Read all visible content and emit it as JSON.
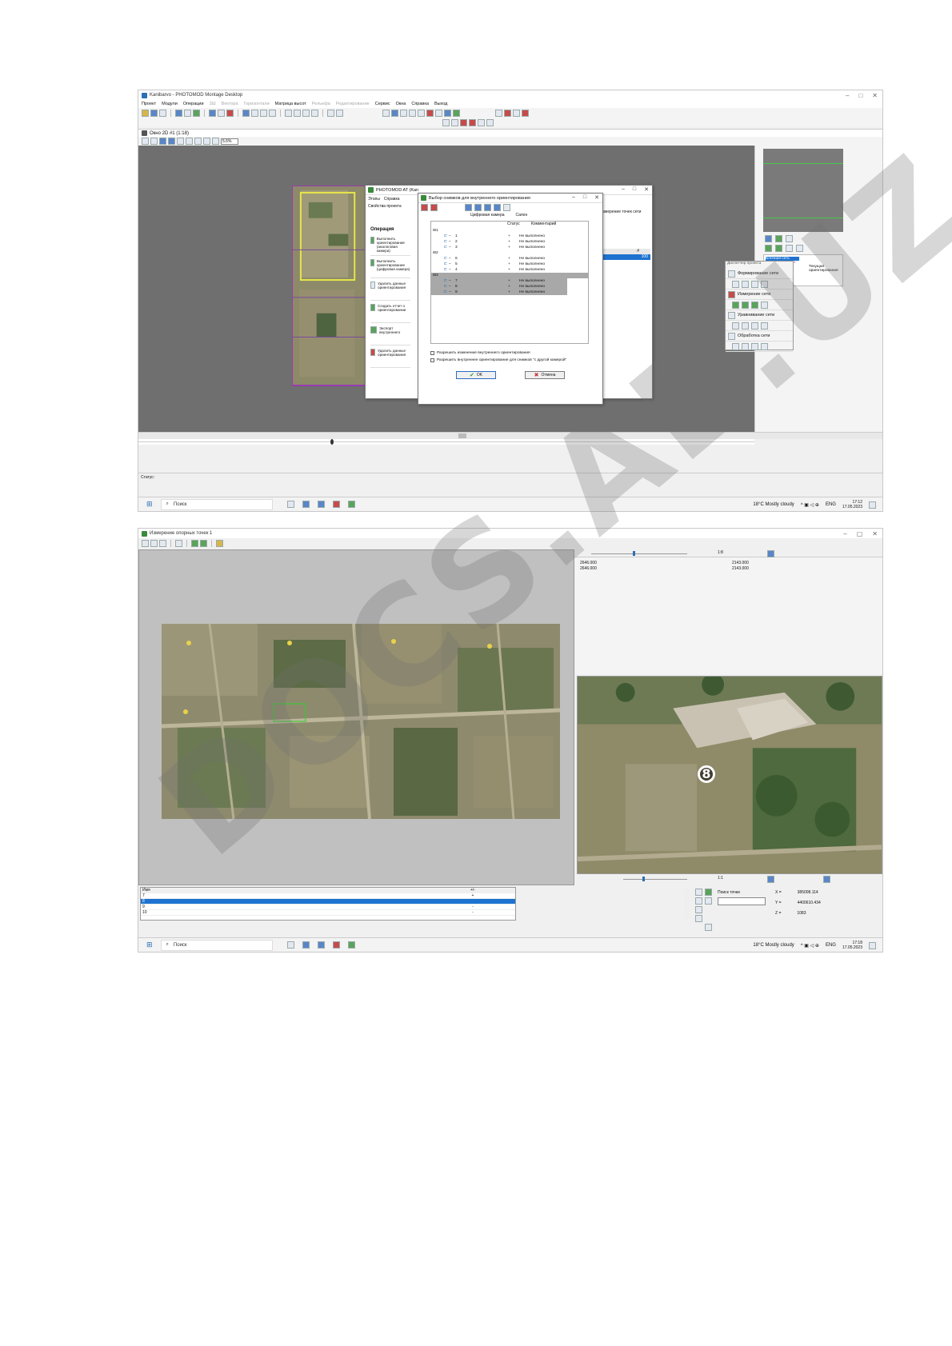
{
  "screenshot1": {
    "window_title": "Kanibarvo - PHOTOMOD Montage Desktop",
    "menu": [
      "Проект",
      "Модули",
      "Операции",
      "3Ш",
      "Вектора",
      "Горизонтали",
      "Матрица высот",
      "Рельефа",
      "Редактирование",
      "Сервис",
      "Окна",
      "Справка",
      "Выход"
    ],
    "menu_disabled": [
      false,
      false,
      false,
      true,
      true,
      true,
      false,
      true,
      true,
      false,
      false,
      false,
      false
    ],
    "doc_window_title": "Окно 2D #1 (1:18)",
    "zoom_value": "5.6%",
    "status_label": "Статус:",
    "at_window": {
      "title": "PHOTOMOD AT (Kan",
      "menu": [
        "Этапы",
        "Справка"
      ],
      "subtab": "Свойства проекта",
      "section_label": "Операция",
      "operations": [
        "Выполнить ориентирование (аналоговая камера)",
        "Выполнить ориентирование (цифровая камера)",
        "Удалить данные ориентирования",
        "Создать отчет о ориентировании",
        "Экспорт внутреннего",
        "Удалить данные ориентирования"
      ],
      "right_tab": "Измерение точек сети",
      "right_col_header": "#",
      "right_value": "100"
    },
    "dialog": {
      "title": "Выбор снимков для внутреннего ориентирования",
      "col_camera": "Цифровая камера",
      "col_sensor": "Сапон",
      "col_status": "Статус",
      "col_comment": "Комментарий",
      "groups": [
        {
          "name": "1",
          "items": [
            {
              "label": "1",
              "status": "+",
              "comment": "Не выполнено"
            },
            {
              "label": "2",
              "status": "+",
              "comment": "Не выполнено"
            },
            {
              "label": "3",
              "status": "+",
              "comment": "Не выполнено"
            }
          ]
        },
        {
          "name": "2",
          "items": [
            {
              "label": "6",
              "status": "+",
              "comment": "Не выполнено"
            },
            {
              "label": "5",
              "status": "+",
              "comment": "Не выполнено"
            },
            {
              "label": "4",
              "status": "+",
              "comment": "Не выполнено"
            }
          ]
        },
        {
          "name": "3",
          "items": [
            {
              "label": "7",
              "status": "+",
              "comment": "Не выполнено"
            },
            {
              "label": "8",
              "status": "+",
              "comment": "Не выполнено"
            },
            {
              "label": "9",
              "status": "+",
              "comment": "Не выполнено"
            }
          ]
        }
      ],
      "option1": "Разрешить изменение внутреннего ориентирования",
      "option2": "Разрешить внутреннее ориентирование для снимков \"с другой камерой\"",
      "ok": "OK",
      "cancel": "Отмена"
    },
    "manager": {
      "title": "Диспетчер проекта",
      "tree_root": "Блочная сеть",
      "tree_item1": "Маркер",
      "tree_item2": "Текущая",
      "tree_item3": "ориентирования",
      "items": [
        "Формирование сети",
        "Измерение сети",
        "Уравнивание сети",
        "Обработка сети"
      ]
    },
    "taskbar": {
      "search": "Поиск",
      "weather": "18°C  Mostly cloudy",
      "lang": "ENG",
      "time": "17:12",
      "date": "17.05.2023"
    }
  },
  "screenshot2": {
    "window_title": "Измерение опорных точек 1",
    "scale_top": "1:8",
    "scale_bottom": "1:1",
    "coords_top": [
      [
        "2646.000",
        "2143.000"
      ],
      [
        "2646.000",
        "2143.000"
      ]
    ],
    "point_label": "8",
    "table": {
      "col_name": "Имя",
      "col_value": "+/-",
      "rows": [
        {
          "name": "7",
          "value": "+",
          "selected": false
        },
        {
          "name": "8",
          "value": "",
          "selected": true
        },
        {
          "name": "9",
          "value": "-",
          "selected": false
        },
        {
          "name": "10",
          "value": "-",
          "selected": false
        }
      ]
    },
    "search_point_label": "Поиск точки",
    "x_label": "X =",
    "x_value": "385008.114",
    "y_label": "Y =",
    "y_value": "4400610.434",
    "z_label": "Z =",
    "z_value": "1083",
    "taskbar": {
      "search": "Поиск",
      "weather": "18°C  Mostly cloudy",
      "lang": "ENG",
      "time": "17:18",
      "date": "17.05.2023"
    }
  },
  "watermark": "DOCS.AB.UZ"
}
